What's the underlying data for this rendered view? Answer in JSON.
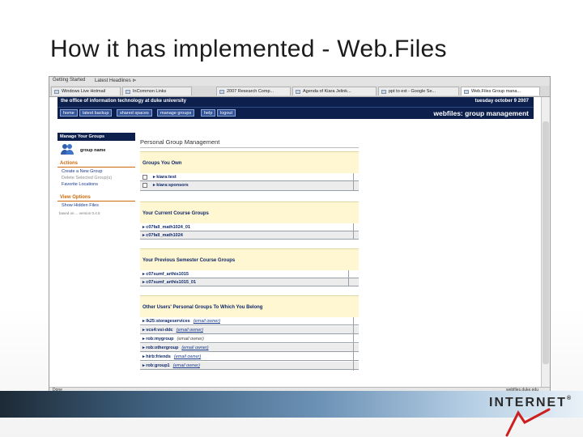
{
  "slide": {
    "title": "How it has implemented - Web.Files",
    "logo_text": "INTERNET",
    "logo_mark": "®"
  },
  "browser": {
    "bookmarks": [
      "Getting Started",
      "Latest Headlines ⊳"
    ],
    "tabs": [
      "Windows Live Hotmail",
      "InCommon Links",
      "2007 Research Comp...",
      "Agenda of Kiara Jelink...",
      "ppt to ext - Google Se...",
      "Web.Files Group mana..."
    ],
    "active_tab_index": 5,
    "status_left": "Done",
    "status_right": "webfiles.duke.edu"
  },
  "site": {
    "header_left": "the office of information technology at duke university",
    "header_right": "tuesday october 9 2007",
    "nav": [
      "home",
      "latest backup",
      "shared spaces",
      "manage groups",
      "help",
      "logout"
    ],
    "section_title": "webfiles: group management"
  },
  "sidebar": {
    "heading": "Manage Your Groups",
    "username": "group name",
    "actions_label": "Actions",
    "actions": [
      "Create a New Group",
      "Delete Selected Group(s)",
      "Favorite Locations"
    ],
    "view_label": "View Options",
    "view_items": [
      "Show Hidden Files"
    ],
    "footer": "based on ... version 0.4.5"
  },
  "main": {
    "title": "Personal Group Management",
    "groups_own": {
      "title": "Groups You Own",
      "rows": [
        "▸ kiara:test",
        "▸ kiara:sponsors"
      ]
    },
    "current_course": {
      "title": "Your Current Course Groups",
      "rows": [
        "▸ c07fall_math1024_01",
        "▸ c07fall_math1024"
      ]
    },
    "previous_course": {
      "title": "Your Previous Semester Course Groups",
      "rows": [
        "▸ c07sumf_arthis1015",
        "▸ c07sumf_arthis1015_01"
      ]
    },
    "other_users": {
      "title": "Other Users' Personal Groups To Which You Belong",
      "rows": [
        {
          "name": "▸ lk25:storageservices",
          "owner": "(email owner)"
        },
        {
          "name": "▸ vcs4:vsi-ddc",
          "owner": "(email owner)"
        },
        {
          "name": "▸ rob:mygroup",
          "owner": "(email owner)"
        },
        {
          "name": "▸ rob:othergroup",
          "owner": "(email owner)"
        },
        {
          "name": "▸ hirb:friends",
          "owner": "(email owner)"
        },
        {
          "name": "▸ rob:group1",
          "owner": "(email owner)"
        }
      ]
    }
  }
}
